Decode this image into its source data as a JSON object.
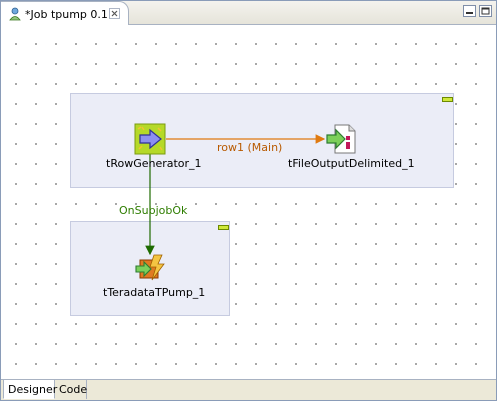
{
  "editor": {
    "tab_title": "*Job tpump 0.1",
    "tab_icon": "job-icon",
    "close_icon": "close-icon",
    "minimize_icon": "minimize-icon",
    "maximize_icon": "maximize-icon"
  },
  "components": [
    {
      "name": "tRowGenerator_1",
      "icon": "row-generator-icon"
    },
    {
      "name": "tFileOutputDelimited_1",
      "icon": "file-output-icon"
    },
    {
      "name": "tTeradataTPump_1",
      "icon": "teradata-tpump-icon"
    }
  ],
  "links": [
    {
      "label": "row1 (Main)",
      "from": "tRowGenerator_1",
      "to": "tFileOutputDelimited_1",
      "color": "#e07a10"
    },
    {
      "label": "OnSubjobOk",
      "from": "tRowGenerator_1",
      "to": "tTeradataTPump_1",
      "color": "#2e7d00"
    }
  ],
  "subjob_colors": {
    "background": "#ebedf7",
    "toggle": "#cfe83a"
  },
  "bottom_tabs": [
    {
      "label": "Designer",
      "active": true
    },
    {
      "label": "Code",
      "active": false
    }
  ]
}
